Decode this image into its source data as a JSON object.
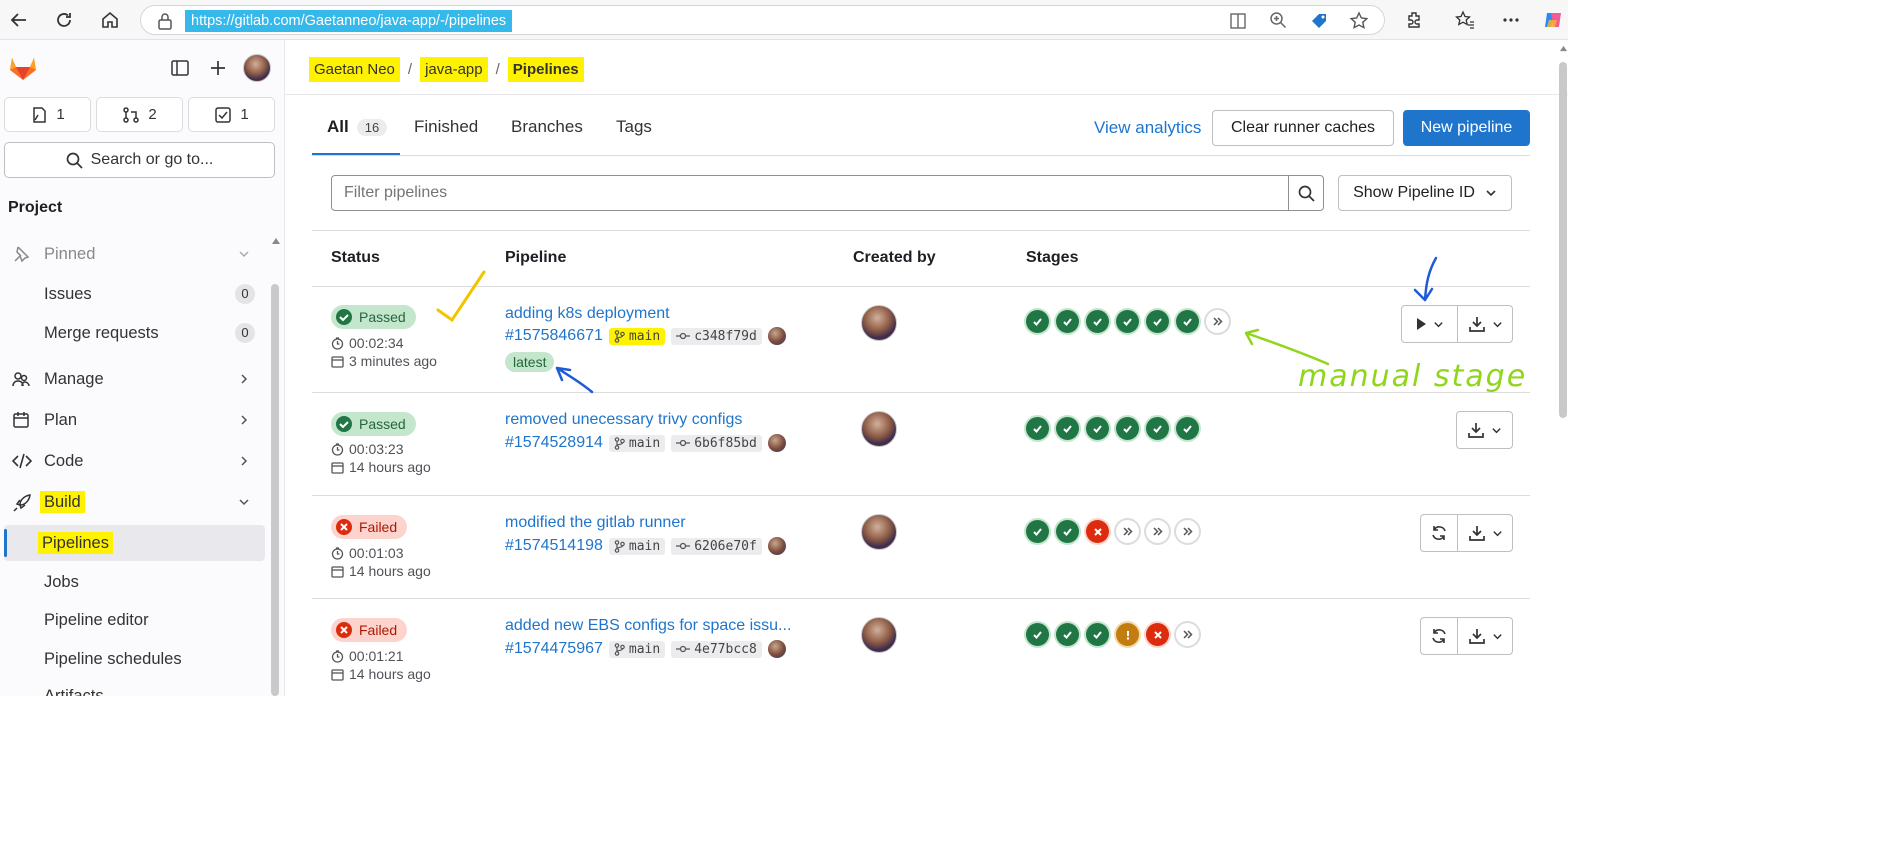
{
  "browser": {
    "url": "https://gitlab.com/Gaetanneo/java-app/-/pipelines"
  },
  "sidebar": {
    "counters": [
      {
        "icon": "issues-icon",
        "count": "1"
      },
      {
        "icon": "merge-request-icon",
        "count": "2"
      },
      {
        "icon": "todo-icon",
        "count": "1"
      }
    ],
    "search_label": "Search or go to...",
    "section_title": "Project",
    "items": {
      "pinned": "Pinned",
      "issues": "Issues",
      "issues_count": "0",
      "merge_requests": "Merge requests",
      "merge_requests_count": "0",
      "manage": "Manage",
      "plan": "Plan",
      "code": "Code",
      "build": "Build",
      "pipelines": "Pipelines",
      "jobs": "Jobs",
      "pipeline_editor": "Pipeline editor",
      "pipeline_schedules": "Pipeline schedules",
      "artifacts": "Artifacts"
    }
  },
  "breadcrumb": [
    "Gaetan Neo",
    "java-app",
    "Pipelines"
  ],
  "tabs": {
    "all": "All",
    "all_count": "16",
    "finished": "Finished",
    "branches": "Branches",
    "tags": "Tags"
  },
  "actions": {
    "view_analytics": "View analytics",
    "clear_caches": "Clear runner caches",
    "new_pipeline": "New pipeline"
  },
  "filter": {
    "placeholder": "Filter pipelines",
    "show_id": "Show Pipeline ID"
  },
  "table": {
    "headers": {
      "status": "Status",
      "pipeline": "Pipeline",
      "created_by": "Created by",
      "stages": "Stages"
    },
    "rows": [
      {
        "status": "Passed",
        "duration": "00:02:34",
        "ago": "3 minutes ago",
        "title": "adding k8s deployment",
        "id": "#1575846671",
        "branch": "main",
        "commit": "c348f79d",
        "badge": "latest",
        "stages": [
          "success",
          "success",
          "success",
          "success",
          "success",
          "success",
          "skipped"
        ]
      },
      {
        "status": "Passed",
        "duration": "00:03:23",
        "ago": "14 hours ago",
        "title": "removed unecessary trivy configs",
        "id": "#1574528914",
        "branch": "main",
        "commit": "6b6f85bd",
        "stages": [
          "success",
          "success",
          "success",
          "success",
          "success",
          "success"
        ]
      },
      {
        "status": "Failed",
        "duration": "00:01:03",
        "ago": "14 hours ago",
        "title": "modified the gitlab runner",
        "id": "#1574514198",
        "branch": "main",
        "commit": "6206e70f",
        "stages": [
          "success",
          "success",
          "failed",
          "skipped",
          "skipped",
          "skipped"
        ]
      },
      {
        "status": "Failed",
        "duration": "00:01:21",
        "ago": "14 hours ago",
        "title": "added new EBS configs for space issu...",
        "id": "#1574475967",
        "branch": "main",
        "commit": "4e77bcc8",
        "stages": [
          "success",
          "success",
          "success",
          "warning",
          "failed",
          "skipped"
        ]
      }
    ]
  },
  "annotations": {
    "manual_stage": "manual stage"
  },
  "colors": {
    "accent": "#1f75cb",
    "highlight": "#fff200",
    "success": "#217645",
    "failed": "#dd2b0e"
  }
}
